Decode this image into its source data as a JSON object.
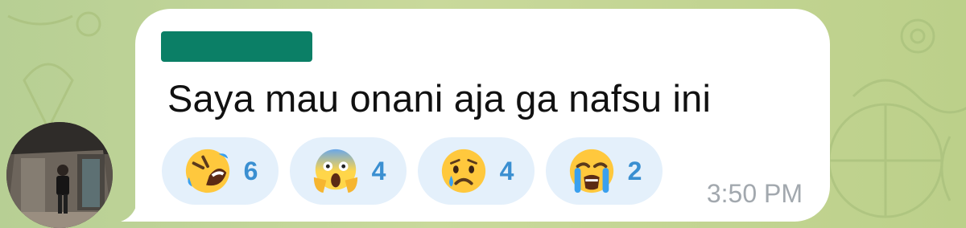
{
  "chat": {
    "message": {
      "sender_name_redacted": true,
      "text": "Saya mau onani aja ga nafsu ini",
      "time": "3:50 PM",
      "reactions": [
        {
          "emoji": "rolling-on-floor-laughing",
          "count": "6"
        },
        {
          "emoji": "face-screaming-in-fear",
          "count": "4"
        },
        {
          "emoji": "crying-face",
          "count": "4"
        },
        {
          "emoji": "loudly-crying-face",
          "count": "2"
        }
      ]
    },
    "avatar": {
      "icon": "user-photo-avatar"
    }
  },
  "colors": {
    "bubble": "#ffffff",
    "sender_redaction": "#0b7f66",
    "reaction_pill": "#e4f0fb",
    "reaction_count": "#3a8fd1",
    "timestamp": "#a2a8ae",
    "wallpaper": "#c3d597"
  }
}
